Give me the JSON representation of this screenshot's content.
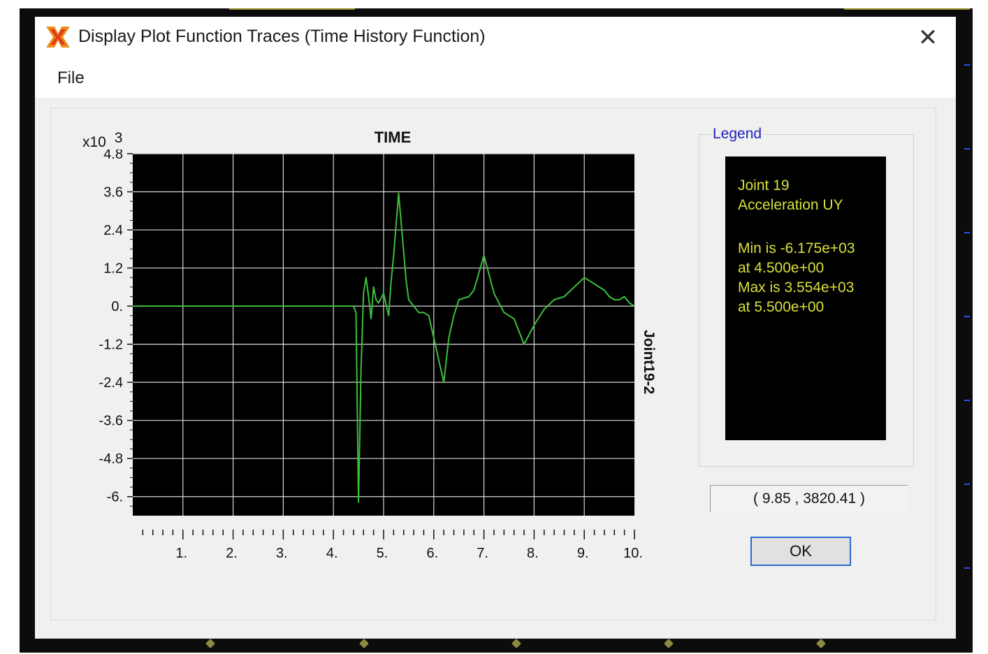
{
  "window": {
    "title": "Display Plot Function Traces  (Time History Function)",
    "close_icon": "close-icon",
    "app_icon": "app-icon"
  },
  "menu": {
    "file": "File"
  },
  "plot": {
    "title": "TIME",
    "multiplier_label": "x10",
    "multiplier_exp": "3",
    "series_label": "Joint19-2",
    "line_color": "#3cc03c",
    "grid_color": "#d8d8d8",
    "background": "#000000"
  },
  "legend": {
    "title": "Legend",
    "lines": [
      "Joint 19",
      "Acceleration  UY",
      "Min is -6.175e+03",
      "at 4.500e+00",
      "Max is 3.554e+03",
      "at 5.500e+00"
    ],
    "text_color": "#d8e03a"
  },
  "cursor_readout": "( 9.85 , 3820.41 )",
  "ok_button": "OK",
  "chart_data": {
    "type": "line",
    "title": "TIME",
    "xlabel": "",
    "ylabel": "",
    "x_ticks": [
      "1.",
      "2.",
      "3.",
      "4.",
      "5.",
      "6.",
      "7.",
      "8.",
      "9.",
      "10."
    ],
    "y_ticks": [
      "4.8",
      "3.6",
      "2.4",
      "1.2",
      "0.",
      "-1.2",
      "-2.4",
      "-3.6",
      "-4.8",
      "-6."
    ],
    "xlim": [
      0,
      10
    ],
    "ylim": [
      -6.6,
      4.8
    ],
    "grid": true,
    "series": [
      {
        "name": "Joint19-2",
        "x": [
          0,
          4.4,
          4.45,
          4.5,
          4.55,
          4.6,
          4.65,
          4.7,
          4.75,
          4.8,
          4.85,
          4.9,
          5.0,
          5.1,
          5.15,
          5.2,
          5.3,
          5.45,
          5.5,
          5.6,
          5.7,
          5.8,
          5.9,
          6.0,
          6.2,
          6.3,
          6.4,
          6.5,
          6.7,
          6.8,
          7.0,
          7.2,
          7.4,
          7.5,
          7.6,
          7.8,
          8.0,
          8.2,
          8.4,
          8.6,
          8.8,
          9.0,
          9.2,
          9.4,
          9.5,
          9.6,
          9.7,
          9.8,
          9.9,
          10.0
        ],
        "y": [
          0,
          0,
          -0.2,
          -6.175,
          -2.0,
          0.4,
          0.9,
          0.3,
          -0.4,
          0.6,
          0.2,
          0.1,
          0.4,
          -0.3,
          0.8,
          1.6,
          3.554,
          0.8,
          0.2,
          0.0,
          -0.2,
          -0.2,
          -0.3,
          -1.0,
          -2.4,
          -1.0,
          -0.3,
          0.2,
          0.3,
          0.5,
          1.6,
          0.4,
          -0.2,
          -0.3,
          -0.4,
          -1.2,
          -0.6,
          -0.1,
          0.2,
          0.3,
          0.6,
          0.9,
          0.7,
          0.5,
          0.3,
          0.2,
          0.2,
          0.3,
          0.1,
          0.0
        ]
      }
    ]
  }
}
